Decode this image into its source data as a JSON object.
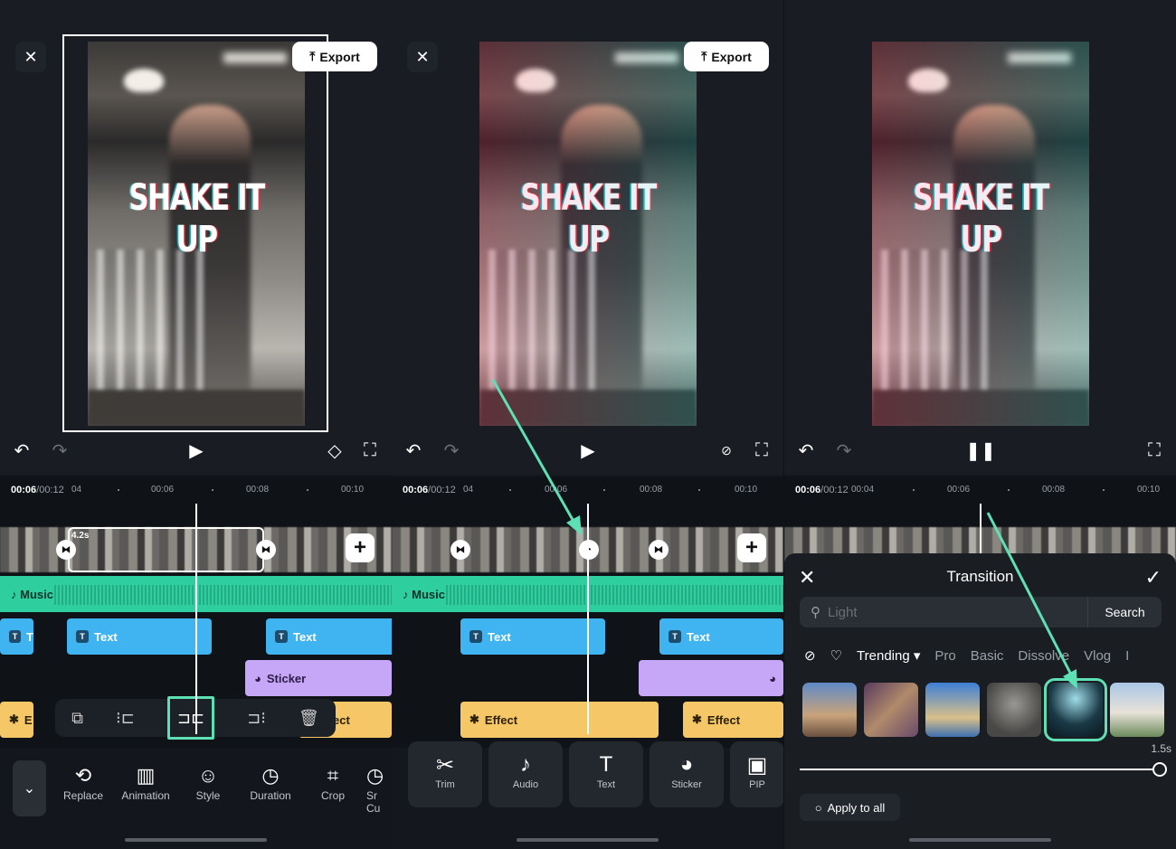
{
  "panel1": {
    "overlay_text": "SHAKE IT UP",
    "close_icon": "close-icon",
    "export_label": "Export",
    "timecode_current": "00:06",
    "timecode_total": "/00:12",
    "ticks": [
      "04",
      "00:06",
      "00:08",
      "00:10"
    ],
    "clip_duration": "4.2s",
    "music_label": "Music",
    "text_tracks": [
      "T",
      "Text",
      "Text"
    ],
    "sticker_label": "Sticker",
    "effect_labels": [
      "E",
      "ect",
      "E"
    ],
    "tools": [
      "Replace",
      "Animation",
      "Style",
      "Duration",
      "Crop",
      "Sr Cu"
    ]
  },
  "panel2": {
    "overlay_text": "SHAKE IT UP",
    "export_label": "Export",
    "timecode_current": "00:06",
    "timecode_total": "/00:12",
    "ticks": [
      "04",
      "00:06",
      "00:08",
      "00:10"
    ],
    "music_label": "Music",
    "text_tracks": [
      "Text",
      "Text"
    ],
    "effect_labels": [
      "Effect",
      "Effect"
    ],
    "tools": [
      "Trim",
      "Audio",
      "Text",
      "Sticker",
      "PIP"
    ]
  },
  "panel3": {
    "overlay_text": "SHAKE IT UP",
    "timecode_current": "00:06",
    "timecode_total": "/00:12",
    "ticks": [
      "00:04",
      "00:06",
      "00:08",
      "00:10"
    ],
    "sheet_title": "Transition",
    "search_placeholder": "Light",
    "search_button": "Search",
    "categories": [
      "Trending",
      "Pro",
      "Basic",
      "Dissolve",
      "Vlog",
      "I"
    ],
    "duration_label": "1.5s",
    "duration_value": 1.0,
    "apply_all": "Apply to all"
  },
  "colors": {
    "accent": "#5ee0b5",
    "text_track": "#3fb4f0",
    "music_track": "#2fce9e",
    "sticker_track": "#c6a6f6",
    "effect_track": "#f5c766"
  }
}
